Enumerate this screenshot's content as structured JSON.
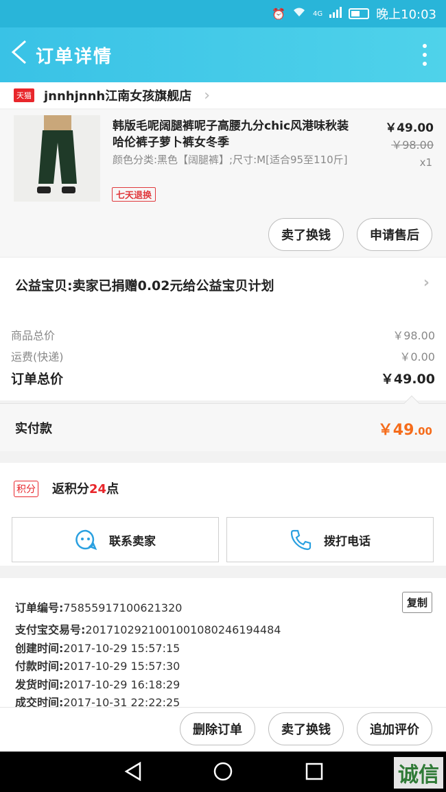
{
  "status_bar": {
    "time": "晚上10:03",
    "network": "4G"
  },
  "app_bar": {
    "title": "订单详情"
  },
  "shop": {
    "badge": "天猫",
    "name": "jnnhjnnh江南女孩旗舰店"
  },
  "product": {
    "title": "韩版毛呢阔腿裤呢子高腰九分chic风港味秋装哈伦裤子萝卜裤女冬季",
    "spec": "颜色分类:黑色【阔腿裤】;尺寸:M[适合95至110斤]",
    "tag": "七天退换",
    "price": "￥49.00",
    "original_price": "￥98.00",
    "quantity": "x1",
    "buttons": [
      "卖了换钱",
      "申请售后"
    ]
  },
  "charity": {
    "text": "公益宝贝:卖家已捐赠0.02元给公益宝贝计划"
  },
  "summary": {
    "goods_label": "商品总价",
    "goods_value": "￥98.00",
    "shipping_label": "运费(快递)",
    "shipping_value": "￥0.00",
    "order_total_label": "订单总价",
    "order_total_value": "￥49.00"
  },
  "paid": {
    "label": "实付款",
    "amount_main": "￥49",
    "amount_cents": ".00"
  },
  "points": {
    "badge": "积分",
    "prefix": "返积分",
    "value": "24",
    "suffix": "点"
  },
  "contact": {
    "seller_label": "联系卖家",
    "call_label": "拨打电话"
  },
  "order_info": {
    "copy_label": "复制",
    "rows": [
      {
        "label": "订单编号:",
        "value": "75855917100621320"
      },
      {
        "label": "支付宝交易号:",
        "value": "2017102921001001080246194484"
      },
      {
        "label": "创建时间:",
        "value": "2017-10-29 15:57:15"
      },
      {
        "label": "付款时间:",
        "value": "2017-10-29 15:57:30"
      },
      {
        "label": "发货时间:",
        "value": "2017-10-29 16:18:29"
      },
      {
        "label": "成交时间:",
        "value": "2017-10-31 22:22:25"
      }
    ]
  },
  "actions": {
    "delete": "删除订单",
    "sell": "卖了换钱",
    "review": "追加评价"
  },
  "watermark": "诚信",
  "colors": {
    "appbar": "#39c2e6",
    "accent_red": "#e8262b",
    "paid_orange": "#f56c1b"
  }
}
